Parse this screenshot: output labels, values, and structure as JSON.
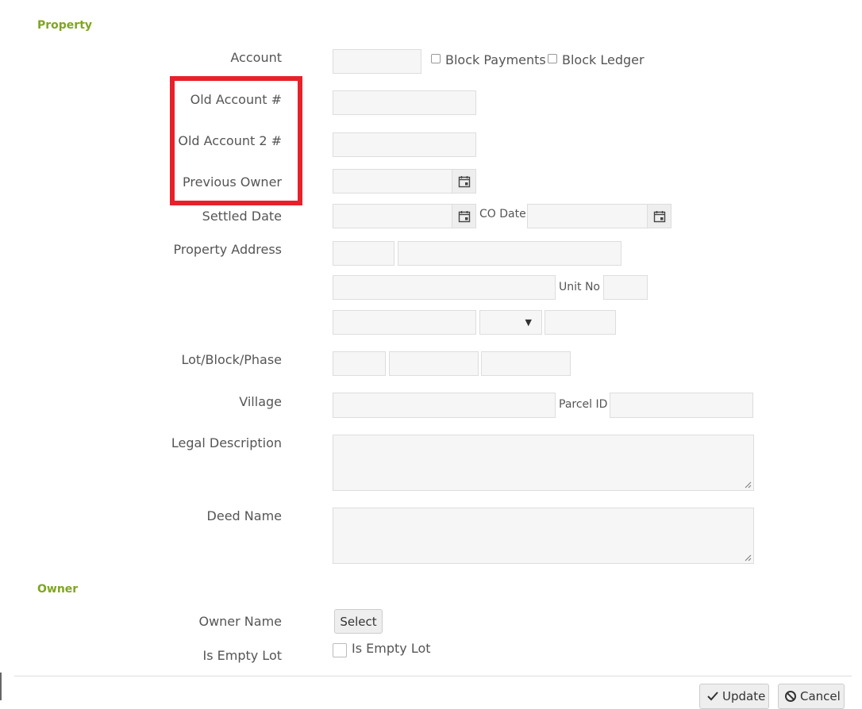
{
  "sections": {
    "property": "Property",
    "owner": "Owner"
  },
  "fields": {
    "account": {
      "label": "Account",
      "value": ""
    },
    "block_payments": {
      "label": "Block Payments",
      "checked": false
    },
    "block_ledger": {
      "label": "Block Ledger",
      "checked": false
    },
    "old_account": {
      "label": "Old Account #",
      "value": ""
    },
    "old_account_2": {
      "label": "Old Account 2 #",
      "value": ""
    },
    "previous_owner": {
      "label": "Previous Owner",
      "value": ""
    },
    "settled_date": {
      "label": "Settled Date",
      "value": ""
    },
    "co_date": {
      "label": "CO Date",
      "value": ""
    },
    "property_address": {
      "label": "Property Address"
    },
    "unit_no": {
      "label": "Unit No",
      "value": ""
    },
    "lot_block_phase": {
      "label": "Lot/Block/Phase"
    },
    "village": {
      "label": "Village",
      "value": ""
    },
    "parcel_id": {
      "label": "Parcel ID",
      "value": ""
    },
    "legal_description": {
      "label": "Legal Description",
      "value": ""
    },
    "deed_name": {
      "label": "Deed Name",
      "value": ""
    },
    "owner_name": {
      "label": "Owner Name",
      "button": "Select"
    },
    "is_empty_lot": {
      "label": "Is Empty Lot",
      "checkbox_label": "Is Empty Lot",
      "checked": false
    }
  },
  "footer": {
    "update": "Update",
    "cancel": "Cancel"
  },
  "colors": {
    "section_title": "#7fa520",
    "highlight": "#e8202a",
    "input_bg": "#f6f6f6"
  }
}
